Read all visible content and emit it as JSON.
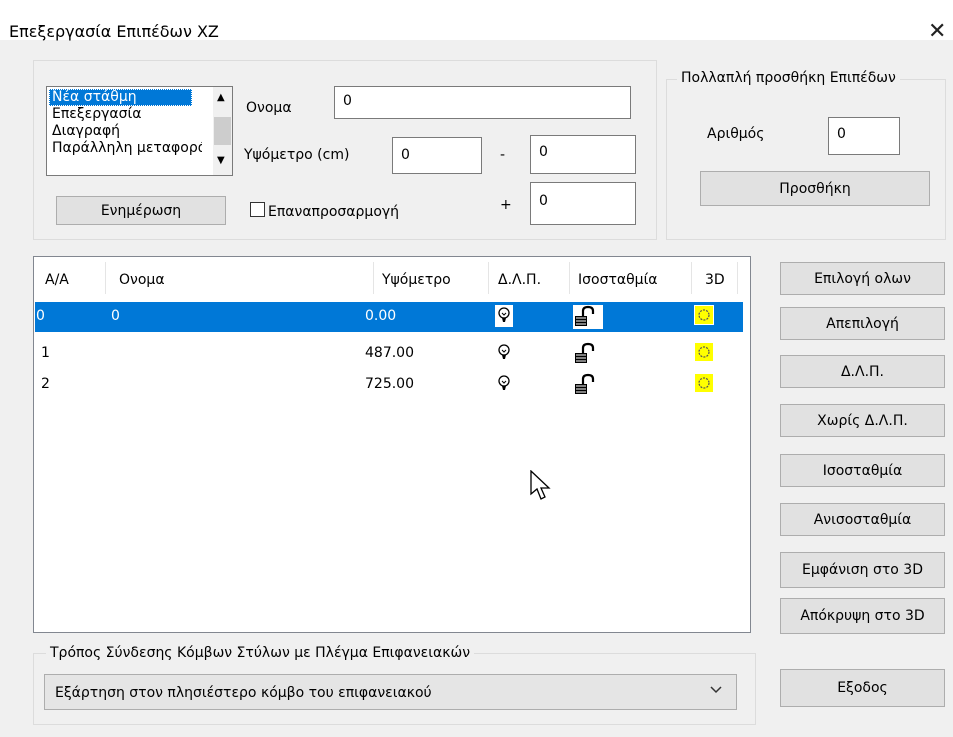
{
  "window": {
    "title": "Επεξεργασία Επιπέδων XZ",
    "close_glyph": "✕"
  },
  "action_list": {
    "items": [
      "Νέα στάθμη",
      "Επεξεργασία",
      "Διαγραφή",
      "Παράλληλη μεταφορά"
    ],
    "selected": "Νέα στάθμη"
  },
  "update_button": "Ενημέρωση",
  "fields": {
    "name_label": "Ονομα",
    "name_value": "0",
    "height_label": "Υψόμετρο (cm)",
    "height_value": "0",
    "minus_label": "-",
    "minus_value": "0",
    "plus_label": "+",
    "plus_value": "0",
    "readjust_label": "Επαναπροσαρμογή",
    "readjust_checked": false
  },
  "multi_add": {
    "group_label": "Πολλαπλή προσθήκη Επιπέδων",
    "count_label": "Αριθμός",
    "count_value": "0",
    "add_button": "Προσθήκη"
  },
  "table": {
    "columns": [
      "Α/Α",
      "Ονομα",
      "Υψόμετρο",
      "Δ.Λ.Π.",
      "Ισοσταθμία",
      "3D"
    ],
    "rows": [
      {
        "aa": "0",
        "name": "0",
        "height": "0.00",
        "dlp_icon": "lightbulb-icon",
        "level_icon": "unlocked-padlock-icon",
        "view3d_icon": "sun-icon",
        "selected": true
      },
      {
        "aa": "1",
        "name": "",
        "height": "487.00",
        "dlp_icon": "lightbulb-icon",
        "level_icon": "unlocked-padlock-icon",
        "view3d_icon": "sun-icon",
        "selected": false
      },
      {
        "aa": "2",
        "name": "",
        "height": "725.00",
        "dlp_icon": "lightbulb-icon",
        "level_icon": "unlocked-padlock-icon",
        "view3d_icon": "sun-icon",
        "selected": false
      }
    ]
  },
  "side_buttons": {
    "select_all": "Επιλογή ολων",
    "deselect": "Απεπιλογή",
    "dlp": "Δ.Λ.Π.",
    "no_dlp": "Χωρίς Δ.Λ.Π.",
    "level": "Ισοσταθμία",
    "unlevel": "Ανισοσταθμία",
    "show_3d": "Εμφάνιση στο 3D",
    "hide_3d": "Απόκρυψη στο 3D",
    "exit": "Εξοδος"
  },
  "connection": {
    "group_label": "Τρόπος Σύνδεσης Κόμβων Στύλων με Πλέγμα Επιφανειακών",
    "selected_option": "Εξάρτηση στον πλησιέστερο κόμβο του επιφανειακού"
  },
  "colors": {
    "selection": "#0078d7",
    "sun_fill": "#ffff00",
    "button_face": "#e1e1e1",
    "dialog_bg": "#f0f0f0"
  }
}
